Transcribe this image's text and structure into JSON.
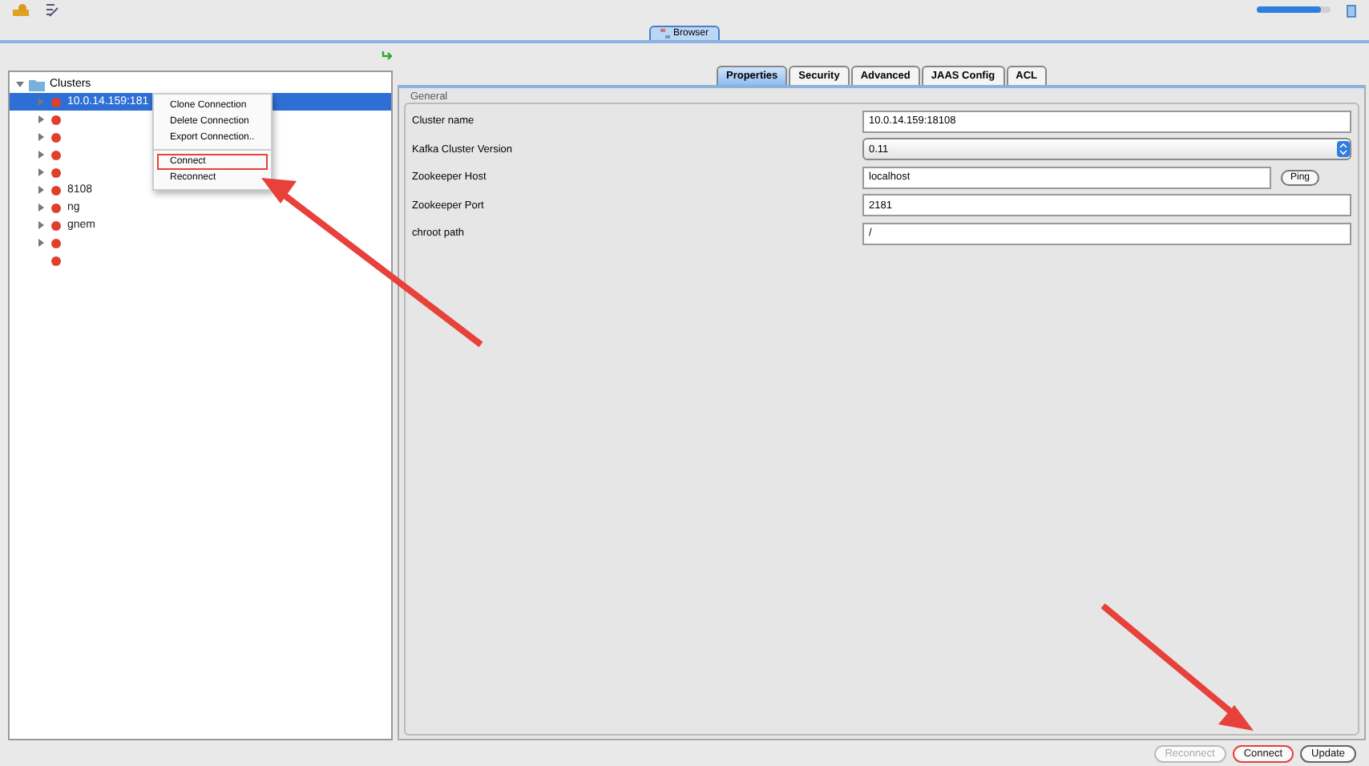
{
  "toolbar": {
    "slider": {
      "level": 0.88
    }
  },
  "view_tabs": [
    {
      "label": "Browser",
      "selected": true
    }
  ],
  "tree": {
    "root": "Clusters",
    "expanded": true,
    "children": [
      {
        "label": "10.0.14.159:181",
        "selected": true,
        "kind": "node"
      },
      {
        "selected": false,
        "kind": "node"
      },
      {
        "selected": false,
        "kind": "node"
      },
      {
        "selected": false,
        "kind": "node"
      },
      {
        "selected": false,
        "kind": "node"
      },
      {
        "label": "8108",
        "selected": false,
        "kind": "node"
      },
      {
        "label": "ng",
        "selected": false,
        "kind": "node"
      },
      {
        "label": "gnem",
        "selected": false,
        "kind": "node"
      },
      {
        "selected": false,
        "kind": "node"
      },
      {
        "selected": false,
        "kind": "leaf"
      }
    ]
  },
  "context_menu": [
    {
      "label": "Clone Connection",
      "kind": "item",
      "highlighted": false
    },
    {
      "label": "Delete Connection",
      "kind": "item",
      "highlighted": false
    },
    {
      "label": "Export Connection..",
      "kind": "item",
      "highlighted": false
    },
    {
      "kind": "separator"
    },
    {
      "label": "Connect",
      "kind": "item",
      "highlighted": true
    },
    {
      "label": "Reconnect",
      "kind": "item",
      "highlighted": false
    }
  ],
  "detail_tabs": [
    {
      "label": "Properties",
      "selected": true
    },
    {
      "label": "Security",
      "selected": false
    },
    {
      "label": "Advanced",
      "selected": false
    },
    {
      "label": "JAAS Config",
      "selected": false
    },
    {
      "label": "ACL",
      "selected": false
    }
  ],
  "group_title": "General",
  "fields": [
    {
      "label": "Cluster name",
      "kind": "text",
      "value": "10.0.14.159:18108"
    },
    {
      "label": "Kafka Cluster Version",
      "kind": "select",
      "value": "0.11"
    },
    {
      "label": "Zookeeper Host",
      "kind": "text",
      "value": "localhost",
      "button": "Ping"
    },
    {
      "label": "Zookeeper Port",
      "kind": "text",
      "value": "2181"
    },
    {
      "label": "chroot path",
      "kind": "text",
      "value": "/"
    }
  ],
  "buttons": [
    {
      "label": "Reconnect",
      "disabled": true,
      "highlighted": false
    },
    {
      "label": "Connect",
      "disabled": false,
      "highlighted": true
    },
    {
      "label": "Update",
      "disabled": false,
      "highlighted": false
    }
  ]
}
